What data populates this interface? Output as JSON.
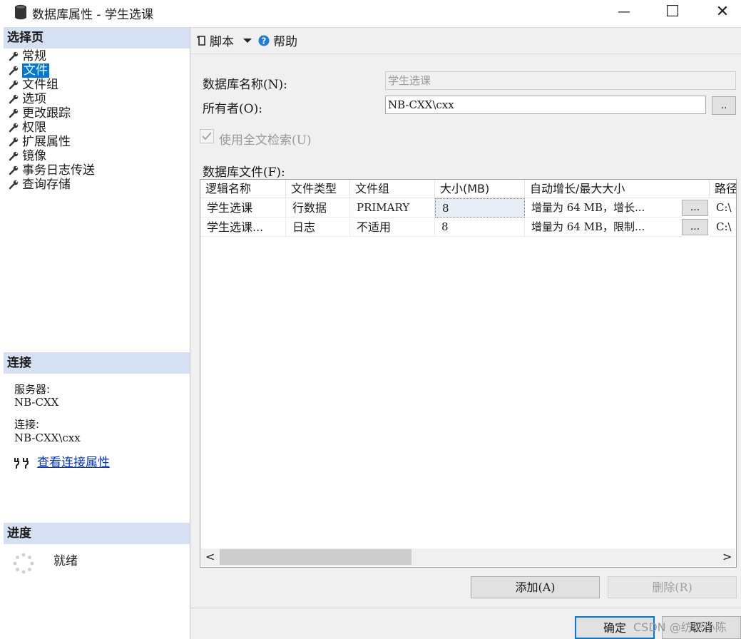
{
  "window": {
    "title": "数据库属性 - 学生选课",
    "controls": {
      "minimize": "—",
      "maximize": "☐",
      "close": "✕"
    }
  },
  "left": {
    "select_page_header": "选择页",
    "pages": [
      "常规",
      "文件",
      "文件组",
      "选项",
      "更改跟踪",
      "权限",
      "扩展属性",
      "镜像",
      "事务日志传送",
      "查询存储"
    ],
    "selected_page": "文件",
    "connection": {
      "header": "连接",
      "server_label": "服务器:",
      "server_value": "NB-CXX",
      "connection_label": "连接:",
      "connection_value": "NB-CXX\\cxx",
      "view_link": "查看连接属性"
    },
    "progress": {
      "header": "进度",
      "status": "就绪"
    }
  },
  "toolbar": {
    "script_label": "脚本",
    "help_label": "帮助"
  },
  "form": {
    "db_name_label": "数据库名称(N):",
    "db_name_value": "学生选课",
    "owner_label": "所有者(O):",
    "owner_value": "NB-CXX\\cxx",
    "browse_label": "..",
    "fulltext_label": "使用全文检索(U)",
    "fulltext_checked": true,
    "files_label": "数据库文件(F):"
  },
  "grid": {
    "headers": [
      "逻辑名称",
      "文件类型",
      "文件组",
      "大小(MB)",
      "自动增长/最大大小",
      "路径"
    ],
    "rows": [
      {
        "logical": "学生选课",
        "type": "行数据",
        "group": "PRIMARY",
        "size": "8",
        "growth": "增量为 64 MB，增长...",
        "dots": "...",
        "path": "C:\\"
      },
      {
        "logical": "学生选课...",
        "type": "日志",
        "group": "不适用",
        "size": "8",
        "growth": "增量为 64 MB，限制...",
        "dots": "...",
        "path": "C:\\"
      }
    ],
    "scroll_left": "<",
    "scroll_right": ">"
  },
  "buttons": {
    "add": "添加(A)",
    "remove": "删除(R)",
    "ok": "确定",
    "cancel": "取消"
  },
  "watermark": "CSDN @纺织小陈"
}
